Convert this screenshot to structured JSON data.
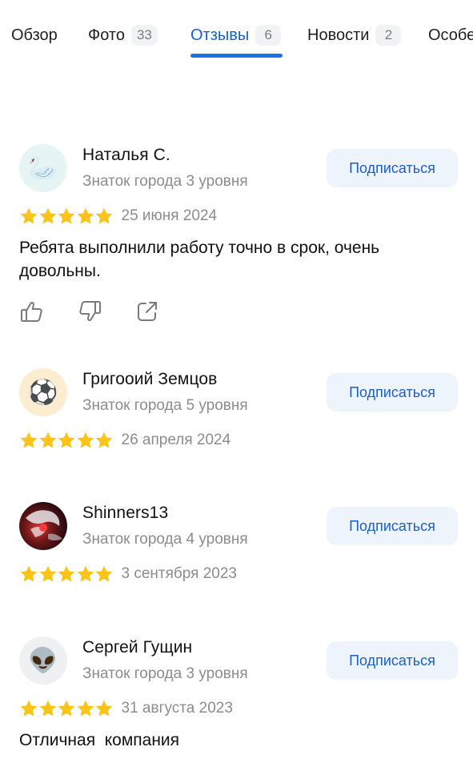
{
  "tabs": [
    {
      "label": "Обзор",
      "count": null,
      "active": false
    },
    {
      "label": "Фото",
      "count": "33",
      "active": false
    },
    {
      "label": "Отзывы",
      "count": "6",
      "active": true
    },
    {
      "label": "Новости",
      "count": "2",
      "active": false
    },
    {
      "label": "Особе",
      "count": null,
      "active": false
    }
  ],
  "subscribe_label": "Подписаться",
  "reviews": [
    {
      "author": "Наталья С.",
      "level": "Знаток города 3 уровня",
      "avatar_icon": "goose-icon",
      "rating": 5,
      "date": "25 июня 2024",
      "text": "Ребята выполнили работу точно в срок, очень довольны."
    },
    {
      "author": "Григоoий Земцов",
      "level": "Знаток города 5 уровня",
      "avatar_icon": "soccer-ball-icon",
      "rating": 5,
      "date": "26 апреля 2024",
      "text": ""
    },
    {
      "author": "Shinners13",
      "level": "Знаток города 4 уровня",
      "avatar_icon": "anime-avatar",
      "rating": 5,
      "date": "3 сентября 2023",
      "text": ""
    },
    {
      "author": "Сергей Гущин",
      "level": "Знаток города 3 уровня",
      "avatar_icon": "alien-icon",
      "rating": 5,
      "date": "31 августа 2023",
      "text": "Отличная  компания"
    }
  ],
  "colors": {
    "accent": "#1a73e8",
    "link": "#1a5fc9",
    "star": "#fcc419",
    "muted": "#8c8c8c",
    "button_bg": "#eef4fb"
  },
  "emoji": {
    "goose": "🦢",
    "ball": "⚽",
    "alien": "👽"
  }
}
